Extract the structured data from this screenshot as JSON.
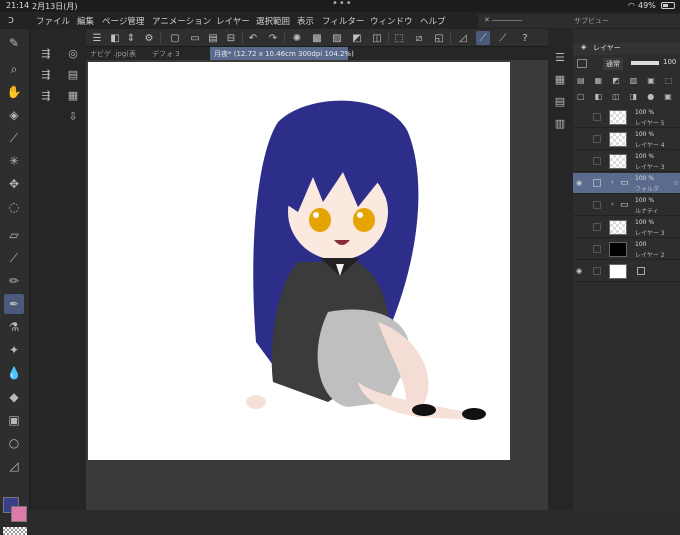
{
  "status": {
    "time": "21:14",
    "date": "2月13日(月)",
    "battery": "49%"
  },
  "menu": {
    "items": [
      "ファイル",
      "編集",
      "ページ管理",
      "アニメーション",
      "レイヤー",
      "選択範囲",
      "表示",
      "フィルター",
      "ウィンドウ",
      "ヘルプ"
    ]
  },
  "subview": {
    "label": "サブビュー"
  },
  "tabs": [
    {
      "label": "ナビゲ .jpg(表",
      "active": false
    },
    {
      "label": "デフォ 3",
      "active": false
    },
    {
      "label": "月夜* (12.72 x 10.46cm 300dpi 104.2%)",
      "active": true
    }
  ],
  "layer_panel": {
    "title": "レイヤー",
    "blend_mode": "通常",
    "opacity": "100",
    "layers": [
      {
        "percent": "100 %",
        "name": "レイヤー 5",
        "thumb": "checker",
        "selected": false,
        "visible": false,
        "folder": false
      },
      {
        "percent": "100 %",
        "name": "レイヤー 4",
        "thumb": "checker",
        "selected": false,
        "visible": false,
        "folder": false
      },
      {
        "percent": "100 %",
        "name": "レイヤー 3",
        "thumb": "checker",
        "selected": false,
        "visible": false,
        "folder": false
      },
      {
        "percent": "100 %",
        "name": "フォルダ",
        "thumb": "folder",
        "selected": true,
        "visible": true,
        "folder": true
      },
      {
        "percent": "100 %",
        "name": "ルナティ",
        "thumb": "folder",
        "selected": false,
        "visible": false,
        "folder": true
      },
      {
        "percent": "100 %",
        "name": "レイヤー 3",
        "thumb": "checker",
        "selected": false,
        "visible": false,
        "folder": false
      },
      {
        "percent": "100",
        "name": "レイヤー 2",
        "thumb": "black",
        "selected": false,
        "visible": false,
        "folder": false
      },
      {
        "percent": "",
        "name": "",
        "thumb": "white",
        "selected": false,
        "visible": true,
        "folder": false
      }
    ]
  },
  "colors": {
    "main": "#3a3f8a",
    "sub": "#e07aa8",
    "accent": "#5a6b8e"
  }
}
